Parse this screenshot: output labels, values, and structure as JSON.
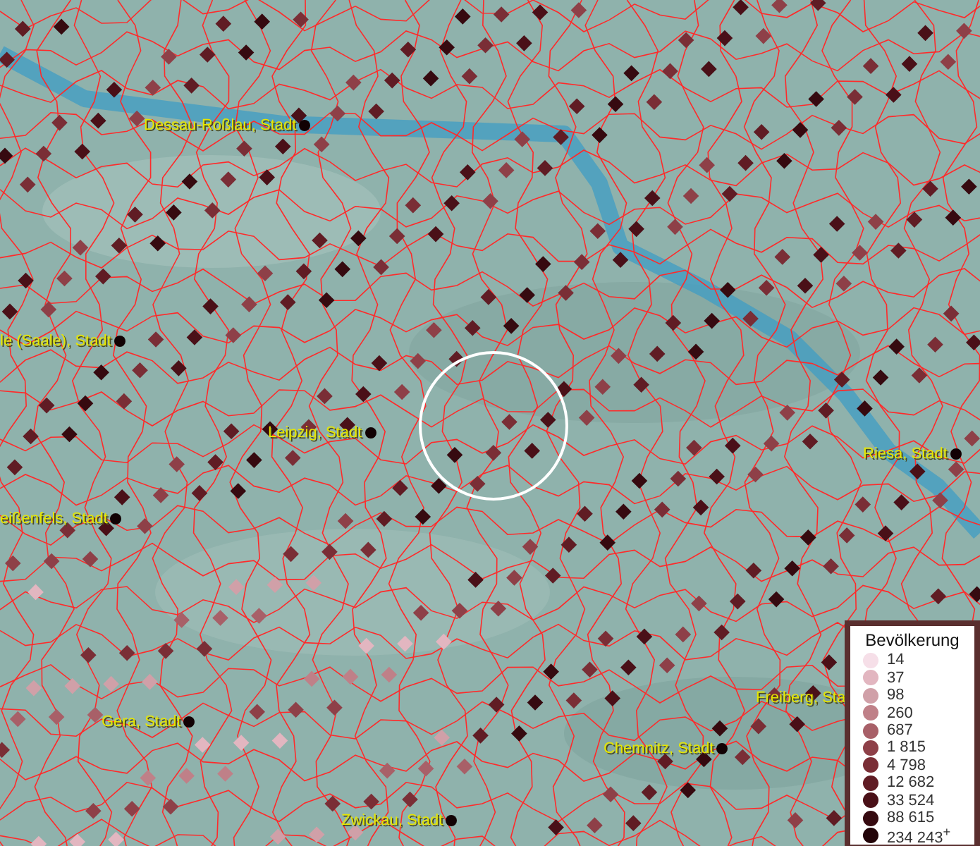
{
  "map": {
    "cities": [
      {
        "label": "Dessau-Roßlau, Stadt"
      },
      {
        "label": "le (Saale), Stadt"
      },
      {
        "label": "Leipzig, Stadt"
      },
      {
        "label": "eißenfels, Stadt"
      },
      {
        "label": "Riesa, Stadt"
      },
      {
        "label": "Gera, Stadt"
      },
      {
        "label": "Chemnitz, Stadt"
      },
      {
        "label": "Freiberg, Sta"
      },
      {
        "label": "Zwickau, Stadt"
      }
    ]
  },
  "legend": {
    "title": "Bevölkerung",
    "items": [
      {
        "value": "14",
        "color": "#f6dfe8"
      },
      {
        "value": "37",
        "color": "#e2b6c0"
      },
      {
        "value": "98",
        "color": "#d0a0a8"
      },
      {
        "value": "260",
        "color": "#bf8088"
      },
      {
        "value": "687",
        "color": "#a86068"
      },
      {
        "value": "1 815",
        "color": "#8e4048"
      },
      {
        "value": "4 798",
        "color": "#7a2e36"
      },
      {
        "value": "12 682",
        "color": "#601c24"
      },
      {
        "value": "33 524",
        "color": "#4a1018"
      },
      {
        "value": "88 615",
        "color": "#360a10"
      },
      {
        "value": "234 243$^{+}$",
        "color": "#220408"
      }
    ]
  }
}
